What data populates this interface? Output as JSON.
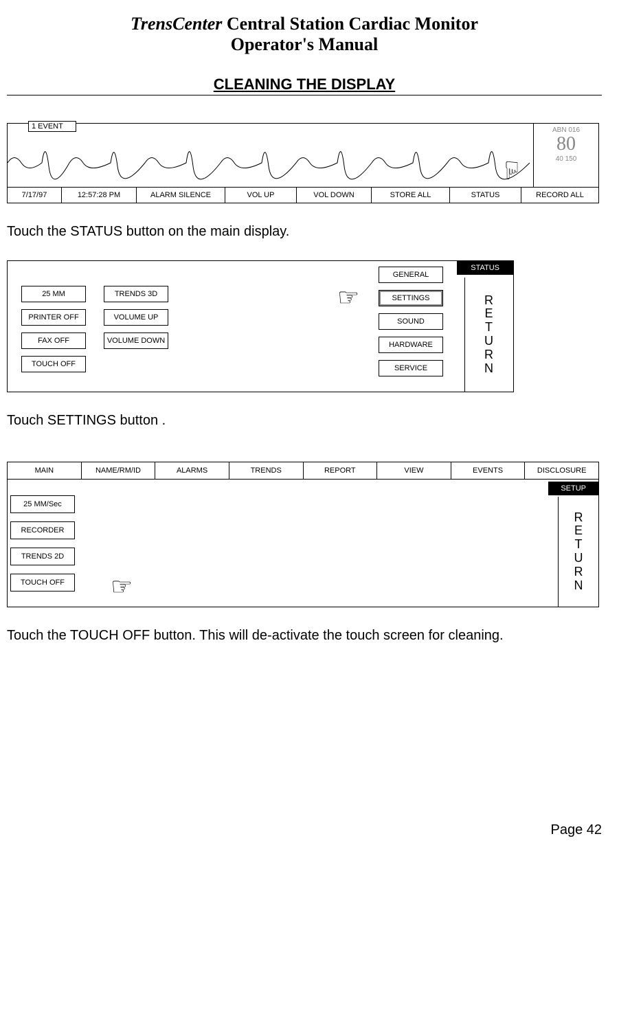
{
  "header": {
    "brand": "TrensCenter",
    "title_rest": " Central Station Cardiac Monitor",
    "subtitle": "Operator's Manual"
  },
  "section_title": "CLEANING THE DISPLAY",
  "fig1": {
    "event_label": "1 EVENT",
    "side": {
      "line1": "ABN 016",
      "big": "80",
      "line2": "40 150"
    },
    "bottom": [
      "7/17/97",
      "12:57:28 PM",
      "ALARM SILENCE",
      "VOL UP",
      "VOL DOWN",
      "STORE ALL",
      "STATUS",
      "RECORD ALL"
    ]
  },
  "text1": "Touch the STATUS button on the main display.",
  "fig2": {
    "status": "STATUS",
    "return": "RETURN",
    "left_col": [
      "25 MM",
      "PRINTER OFF",
      "FAX OFF",
      "TOUCH OFF"
    ],
    "mid_col": [
      "TRENDS 3D",
      "VOLUME UP",
      "VOLUME DOWN"
    ],
    "right_col": [
      "GENERAL",
      "SETTINGS",
      "SOUND",
      "HARDWARE",
      "SERVICE"
    ]
  },
  "text2": "Touch SETTINGS button .",
  "fig3": {
    "top": [
      "MAIN",
      "NAME/RM/ID",
      "ALARMS",
      "TRENDS",
      "REPORT",
      "VIEW",
      "EVENTS",
      "DISCLOSURE"
    ],
    "setup": "SETUP",
    "return": "RETURN",
    "left_col": [
      "25 MM/Sec",
      "RECORDER",
      "TRENDS 2D",
      "TOUCH OFF"
    ]
  },
  "text3": "Touch the TOUCH OFF button.  This will de-activate the touch screen for cleaning.",
  "page_num": "Page 42"
}
